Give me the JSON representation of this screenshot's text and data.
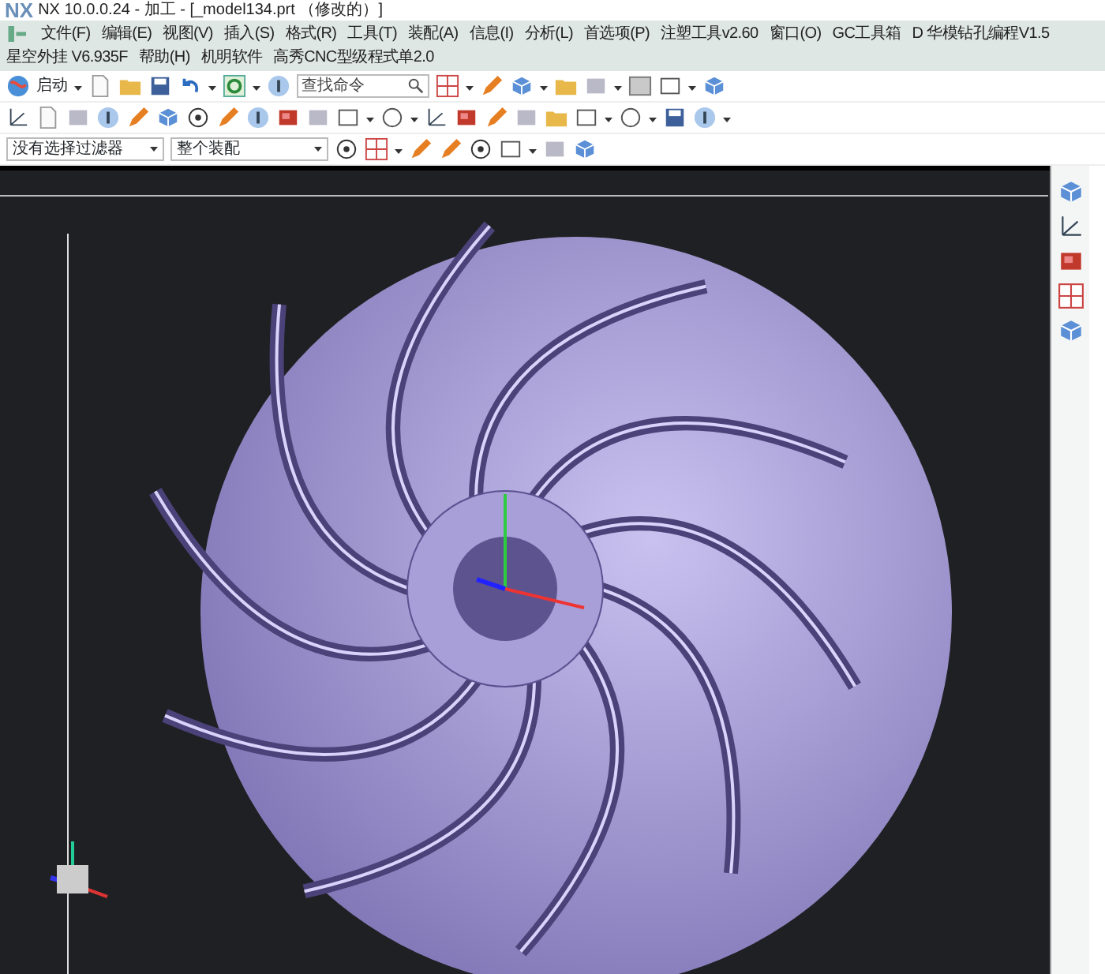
{
  "window": {
    "logo": "NX",
    "title": "NX 10.0.0.24 - 加工 - [_model134.prt （修改的）]"
  },
  "menu": [
    "文件(F)",
    "编辑(E)",
    "视图(V)",
    "插入(S)",
    "格式(R)",
    "工具(T)",
    "装配(A)",
    "信息(I)",
    "分析(L)",
    "首选项(P)",
    "注塑工具v2.60",
    "窗口(O)",
    "GC工具箱",
    "D 华模钻孔编程V1.5",
    "星空外挂 V6.935F",
    "帮助(H)",
    "机明软件",
    "高秀CNC型级程式单2.0"
  ],
  "toolbar": {
    "start_label": "启动",
    "search": {
      "placeholder": "查找命令"
    }
  },
  "filter_bar": {
    "selection_filter": "没有选择过滤器",
    "assembly_scope": "整个装配"
  }
}
